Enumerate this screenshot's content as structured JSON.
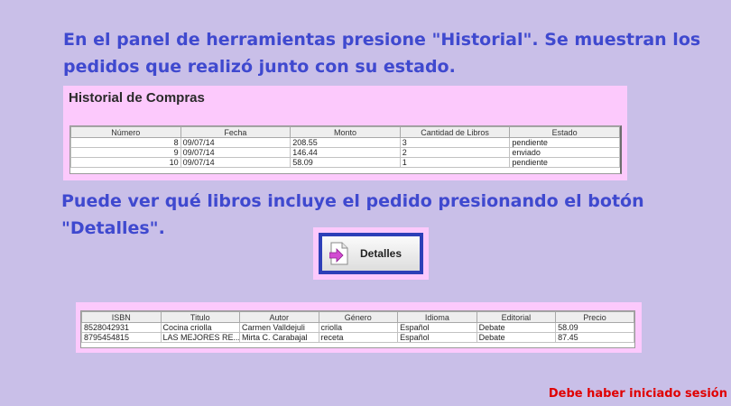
{
  "instructions": {
    "step1": "En el panel de herramientas presione \"Historial\". Se muestran los pedidos que realizó junto con su estado.",
    "step2": "Puede ver qué libros incluye el pedido presionando el botón \"Detalles\"."
  },
  "history": {
    "title": "Historial de Compras",
    "columns": [
      "Número",
      "Fecha",
      "Monto",
      "Cantidad de Libros",
      "Estado"
    ],
    "rows": [
      [
        "8",
        "09/07/14",
        "208.55",
        "3",
        "pendiente"
      ],
      [
        "9",
        "09/07/14",
        "146.44",
        "2",
        "enviado"
      ],
      [
        "10",
        "09/07/14",
        "58.09",
        "1",
        "pendiente"
      ]
    ]
  },
  "details_button": {
    "label": "Detalles",
    "icon": "document-arrow-icon"
  },
  "books": {
    "columns": [
      "ISBN",
      "Titulo",
      "Autor",
      "Género",
      "Idioma",
      "Editorial",
      "Precio"
    ],
    "rows": [
      [
        "8528042931",
        "Cocina criolla",
        "Carmen Valldejuli",
        "criolla",
        "Español",
        "Debate",
        "58.09"
      ],
      [
        "8795454815",
        "LAS MEJORES RE...",
        "Mirta C. Carabajal",
        "receta",
        "Español",
        "Debate",
        "87.45"
      ]
    ]
  },
  "footer": {
    "note": "Debe haber iniciado sesión"
  },
  "colors": {
    "background": "#c9bfe8",
    "instruction_text": "#3f49cf",
    "panel_bg": "#fcc9fc",
    "highlight_border": "#2d3fb8",
    "warning_text": "#e00000"
  }
}
